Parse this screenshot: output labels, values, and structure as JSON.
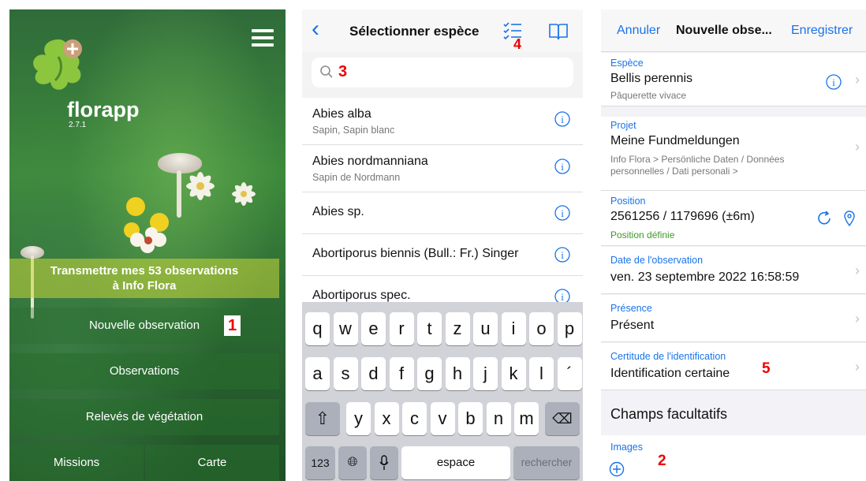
{
  "home": {
    "brand": "florapp",
    "version": "2.7.1",
    "banner_line1": "Transmettre mes 53 observations",
    "banner_line2": "à Info Flora",
    "new_observation": "Nouvelle observation",
    "observations": "Observations",
    "releves": "Relevés de végétation",
    "missions": "Missions",
    "carte": "Carte",
    "badge": "1"
  },
  "species": {
    "title": "Sélectionner espèce",
    "search_placeholder": "",
    "badge_search": "3",
    "badge_list": "4",
    "items": [
      {
        "name": "Abies alba",
        "sub": "Sapin, Sapin blanc"
      },
      {
        "name": "Abies nordmanniana",
        "sub": "Sapin de Nordmann"
      },
      {
        "name": "Abies sp.",
        "sub": ""
      },
      {
        "name": "Abortiporus biennis (Bull.: Fr.) Singer",
        "sub": ""
      },
      {
        "name": "Abortiporus spec.",
        "sub": ""
      }
    ],
    "keyboard": {
      "row1": [
        "q",
        "w",
        "e",
        "r",
        "t",
        "z",
        "u",
        "i",
        "o",
        "p"
      ],
      "row2": [
        "a",
        "s",
        "d",
        "f",
        "g",
        "h",
        "j",
        "k",
        "l",
        "´"
      ],
      "row3": [
        "y",
        "x",
        "c",
        "v",
        "b",
        "n",
        "m"
      ],
      "numbers": "123",
      "space": "espace",
      "search": "rechercher"
    }
  },
  "observation": {
    "cancel": "Annuler",
    "title": "Nouvelle obse...",
    "save": "Enregistrer",
    "espece_label": "Espèce",
    "espece_value": "Bellis perennis",
    "espece_sub": "Pâquerette vivace",
    "projet_label": "Projet",
    "projet_value": "Meine Fundmeldungen",
    "projet_sub1": "Info Flora > Persönliche Daten / Données",
    "projet_sub2": "personnelles / Dati personali >",
    "position_label": "Position",
    "position_value": "2561256 / 1179696 (±6m)",
    "position_status": "Position définie",
    "date_label": "Date de l'observation",
    "date_value": "ven. 23 septembre 2022 16:58:59",
    "presence_label": "Présence",
    "presence_value": "Présent",
    "certitude_label": "Certitude de l'identification",
    "certitude_value": "Identification certaine",
    "badge_certitude": "5",
    "section_optional": "Champs facultatifs",
    "images_label": "Images",
    "badge_images": "2"
  },
  "colors": {
    "accent": "#1a73e8",
    "badge": "#e00000",
    "green_status": "#3c9a23"
  }
}
